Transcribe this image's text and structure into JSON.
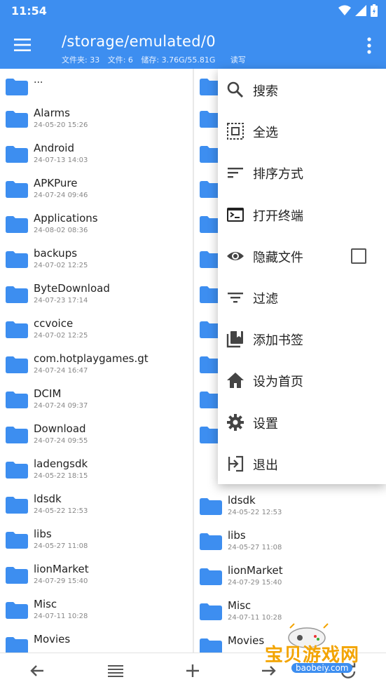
{
  "status_bar": {
    "time": "11:54"
  },
  "appbar": {
    "path": "/storage/emulated/0",
    "folders": "文件夹: 33",
    "files": "文件: 6",
    "storage": "储存: 3.76G/55.81G",
    "mode": "读写"
  },
  "left_pane": {
    "up": "...",
    "items": [
      {
        "name": "Alarms",
        "date": "24-05-20 15:26"
      },
      {
        "name": "Android",
        "date": "24-07-13 14:03"
      },
      {
        "name": "APKPure",
        "date": "24-07-24 09:46"
      },
      {
        "name": "Applications",
        "date": "24-08-02 08:36"
      },
      {
        "name": "backups",
        "date": "24-07-02 12:25"
      },
      {
        "name": "ByteDownload",
        "date": "24-07-23 17:14"
      },
      {
        "name": "ccvoice",
        "date": "24-07-02 12:25"
      },
      {
        "name": "com.hotplaygames.gt",
        "date": "24-07-24 16:47"
      },
      {
        "name": "DCIM",
        "date": "24-07-24 09:37"
      },
      {
        "name": "Download",
        "date": "24-07-24 09:55"
      },
      {
        "name": "ladengsdk",
        "date": "24-05-22 18:15"
      },
      {
        "name": "ldsdk",
        "date": "24-05-22 12:53"
      },
      {
        "name": "libs",
        "date": "24-05-27 11:08"
      },
      {
        "name": "lionMarket",
        "date": "24-07-29 15:40"
      },
      {
        "name": "Misc",
        "date": "24-07-11 10:28"
      },
      {
        "name": "Movies",
        "date": ""
      }
    ]
  },
  "right_pane": {
    "items": [
      {
        "name": "ldsdk",
        "date": "24-05-22 12:53"
      },
      {
        "name": "libs",
        "date": "24-05-27 11:08"
      },
      {
        "name": "lionMarket",
        "date": "24-07-29 15:40"
      },
      {
        "name": "Misc",
        "date": "24-07-11 10:28"
      },
      {
        "name": "Movies",
        "date": ""
      }
    ]
  },
  "overflow_menu": {
    "search": "搜索",
    "select_all": "全选",
    "sort": "排序方式",
    "terminal": "打开终端",
    "hidden_files": "隐藏文件",
    "filter": "过滤",
    "bookmark": "添加书签",
    "set_home": "设为首页",
    "settings": "设置",
    "exit": "退出"
  },
  "watermark": {
    "title": "宝贝游戏网",
    "url": "baobeiy.com"
  },
  "colors": {
    "accent": "#3d8ef0",
    "folder": "#3d8ef0"
  }
}
